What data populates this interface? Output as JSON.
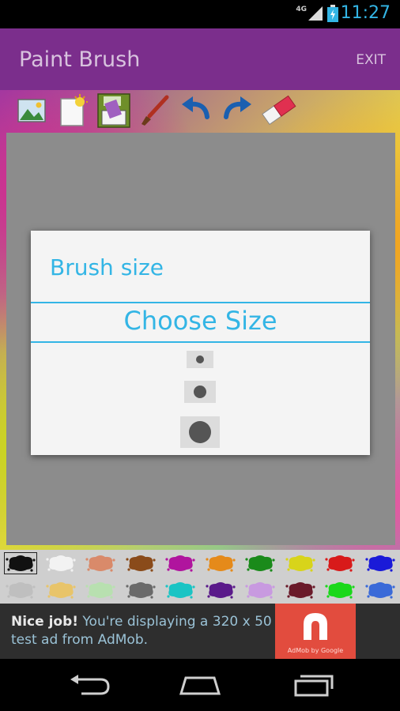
{
  "status_bar": {
    "time": "11:27",
    "network": "4G",
    "accent_color": "#33b5e5"
  },
  "app_bar": {
    "title": "Paint Brush",
    "exit_label": "EXIT",
    "color": "#7b2e8c"
  },
  "toolbar": {
    "tools": [
      "gallery-icon",
      "new-page-icon",
      "save-icon",
      "brush-icon",
      "undo-icon",
      "redo-icon",
      "eraser-icon"
    ]
  },
  "dialog": {
    "title": "Brush size",
    "subtitle": "Choose Size",
    "sizes": [
      "small",
      "medium",
      "large"
    ],
    "accent_color": "#33b5e5"
  },
  "palette": {
    "row1": [
      "#111111",
      "#f2f2f2",
      "#d98a6a",
      "#8a4b1a",
      "#b0149e",
      "#e58a1a",
      "#1a8a1a",
      "#d8d41a",
      "#d81a1a",
      "#1a1ad8"
    ],
    "row2": [
      "#bfbfbf",
      "#e8c46a",
      "#b8e0b0",
      "#6a6a6a",
      "#1ac4c4",
      "#5a1a8a",
      "#c89ae0",
      "#6a1a2a",
      "#1ad81a",
      "#3a6ad8"
    ],
    "selected_index": 0
  },
  "ad": {
    "headline": "Nice job!",
    "body": " You're displaying a 320 x 50 test ad from AdMob.",
    "logo_caption": "AdMob by Google"
  },
  "nav_bar": {
    "buttons": [
      "back-icon",
      "home-icon",
      "recents-icon"
    ]
  }
}
